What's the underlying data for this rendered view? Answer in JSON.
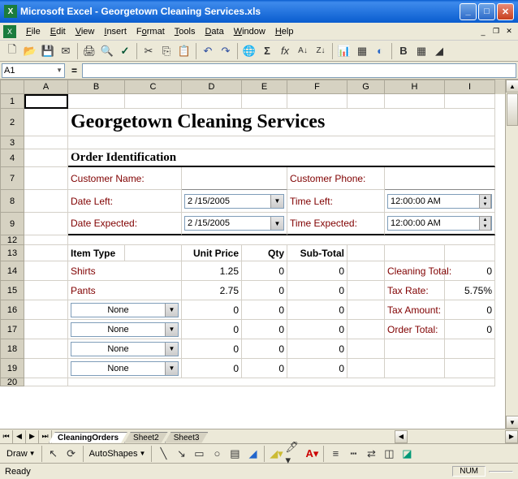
{
  "titlebar": {
    "text": "Microsoft Excel - Georgetown Cleaning Services.xls"
  },
  "menubar": {
    "items": [
      "File",
      "Edit",
      "View",
      "Insert",
      "Format",
      "Tools",
      "Data",
      "Window",
      "Help"
    ]
  },
  "name_box": {
    "value": "A1"
  },
  "columns": [
    "A",
    "B",
    "C",
    "D",
    "E",
    "F",
    "G",
    "H",
    "I"
  ],
  "col_widths": [
    "cA",
    "cB",
    "cC",
    "cD",
    "cE",
    "cF",
    "cG",
    "cH",
    "cI"
  ],
  "rows": [
    "1",
    "2",
    "3",
    "4",
    "7",
    "8",
    "9",
    "12",
    "13",
    "14",
    "15",
    "16",
    "17",
    "18",
    "19",
    "20"
  ],
  "content": {
    "title": "Georgetown Cleaning Services",
    "section": "Order Identification",
    "labels": {
      "customer_name": "Customer Name:",
      "customer_phone": "Customer Phone:",
      "date_left": "Date Left:",
      "time_left": "Time Left:",
      "date_expected": "Date Expected:",
      "time_expected": "Time Expected:"
    },
    "dates": {
      "date_left": "2 /15/2005",
      "date_expected": "2 /15/2005",
      "time_left": "12:00:00 AM",
      "time_expected": "12:00:00 AM"
    },
    "headers": {
      "item_type": "Item Type",
      "unit_price": "Unit Price",
      "qty": "Qty",
      "sub_total": "Sub-Total"
    },
    "items": [
      {
        "name": "Shirts",
        "price": "1.25",
        "qty": "0",
        "sub": "0",
        "dropdown": false
      },
      {
        "name": "Pants",
        "price": "2.75",
        "qty": "0",
        "sub": "0",
        "dropdown": false
      },
      {
        "name": "None",
        "price": "0",
        "qty": "0",
        "sub": "0",
        "dropdown": true
      },
      {
        "name": "None",
        "price": "0",
        "qty": "0",
        "sub": "0",
        "dropdown": true
      },
      {
        "name": "None",
        "price": "0",
        "qty": "0",
        "sub": "0",
        "dropdown": true
      },
      {
        "name": "None",
        "price": "0",
        "qty": "0",
        "sub": "0",
        "dropdown": true
      }
    ],
    "totals": {
      "cleaning_total_lbl": "Cleaning Total:",
      "cleaning_total": "0",
      "tax_rate_lbl": "Tax Rate:",
      "tax_rate": "5.75%",
      "tax_amount_lbl": "Tax Amount:",
      "tax_amount": "0",
      "order_total_lbl": "Order Total:",
      "order_total": "0"
    }
  },
  "sheets": [
    "CleaningOrders",
    "Sheet2",
    "Sheet3"
  ],
  "draw_tb": {
    "draw": "Draw",
    "autoshapes": "AutoShapes"
  },
  "status": {
    "ready": "Ready",
    "num": "NUM"
  }
}
